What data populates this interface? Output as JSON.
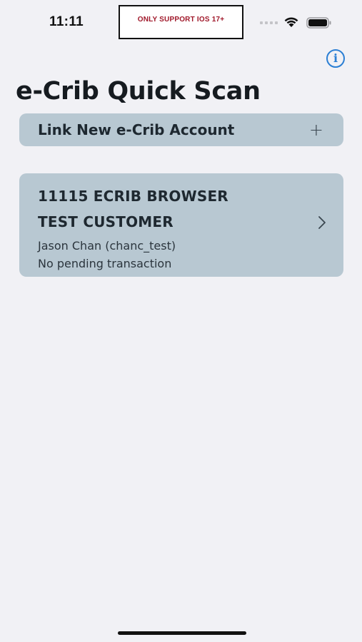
{
  "status_bar": {
    "time": "11:11",
    "notice": "ONLY SUPPORT IOS 17+",
    "icons": [
      "signal-icon",
      "wifi-icon",
      "battery-icon"
    ]
  },
  "header": {
    "info_icon": "info-icon",
    "title": "e-Crib Quick Scan"
  },
  "link_account": {
    "label": "Link New e-Crib Account",
    "icon": "plus-icon",
    "icon_glyph": "+"
  },
  "accounts": [
    {
      "name_line1": "11115 ECRIB BROWSER",
      "name_line2": "TEST CUSTOMER",
      "user": "Jason Chan (chanc_test)",
      "status": "No pending transaction",
      "icon": "chevron-right-icon"
    }
  ],
  "colors": {
    "background": "#f1f1f5",
    "card": "#b8c8d2",
    "accent": "#2b7fd4",
    "notice_text": "#a0182a"
  }
}
